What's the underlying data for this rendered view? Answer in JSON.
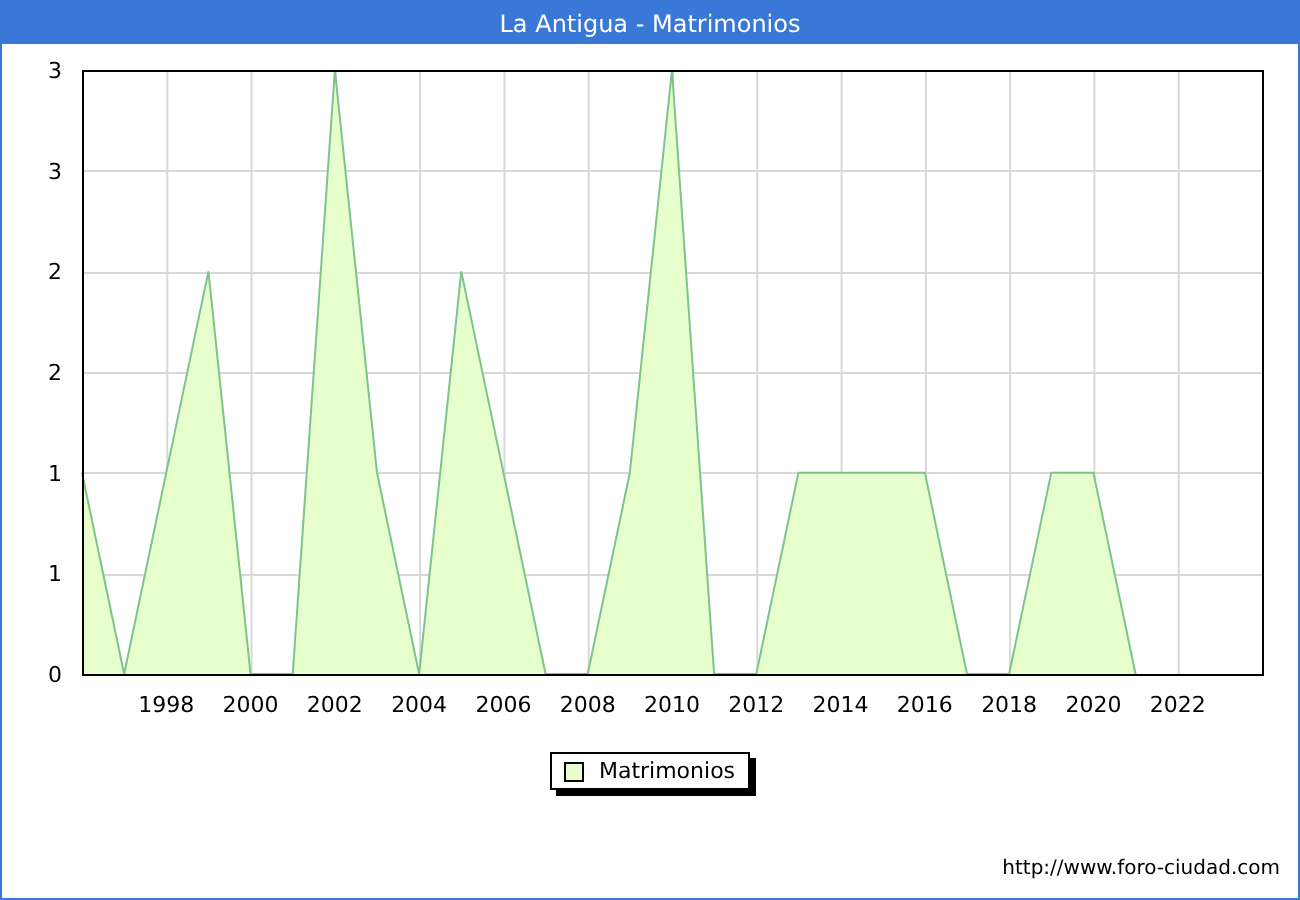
{
  "window": {
    "title": "La Antigua - Matrimonios"
  },
  "chart_data": {
    "type": "area",
    "x": [
      1996,
      1997,
      1998,
      1999,
      2000,
      2001,
      2002,
      2003,
      2004,
      2005,
      2006,
      2007,
      2008,
      2009,
      2010,
      2011,
      2012,
      2013,
      2014,
      2015,
      2016,
      2017,
      2018,
      2019,
      2020,
      2021
    ],
    "series": [
      {
        "name": "Matrimonios",
        "color": "#e6ffcc",
        "values": [
          1,
          0,
          1,
          2,
          0,
          0,
          3,
          1,
          0,
          2,
          1,
          0,
          0,
          1,
          3,
          0,
          0,
          1,
          1,
          1,
          1,
          0,
          0,
          1,
          1,
          0
        ]
      }
    ],
    "grid": true,
    "xlim": [
      1996,
      2024
    ],
    "ylim": [
      0,
      3
    ],
    "xticks": [
      1998,
      2000,
      2002,
      2004,
      2006,
      2008,
      2010,
      2012,
      2014,
      2016,
      2018,
      2020,
      2022
    ],
    "yticks": [
      {
        "value": 0,
        "label": "0"
      },
      {
        "value": 0.5,
        "label": "1"
      },
      {
        "value": 1,
        "label": "1"
      },
      {
        "value": 1.5,
        "label": "2"
      },
      {
        "value": 2,
        "label": "2"
      },
      {
        "value": 2.5,
        "label": "3"
      },
      {
        "value": 3,
        "label": "3"
      }
    ]
  },
  "footer": {
    "url": "http://www.foro-ciudad.com"
  }
}
